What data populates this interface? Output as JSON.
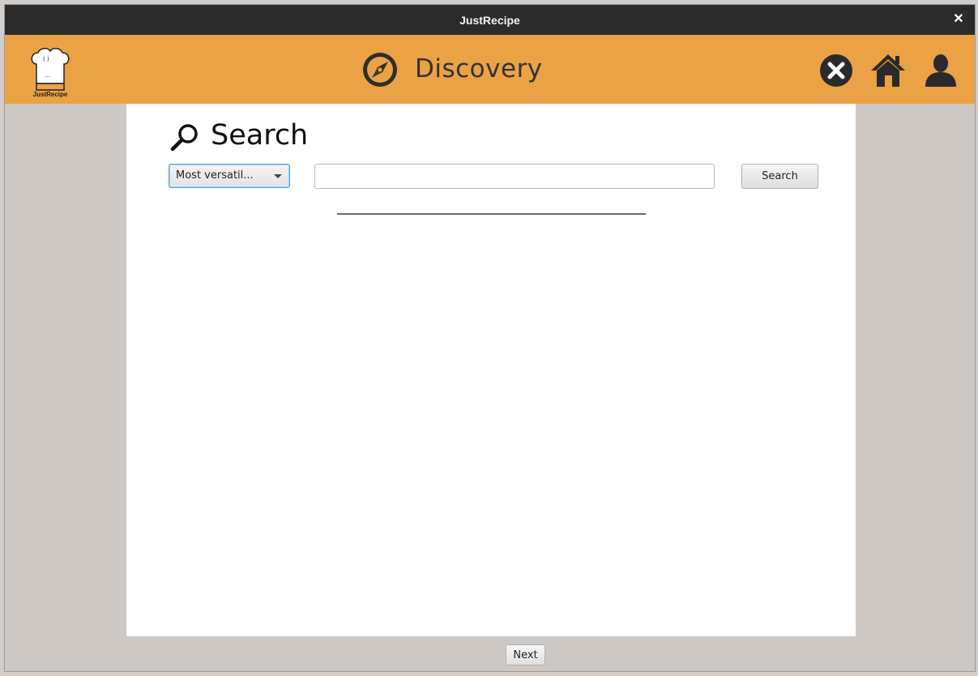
{
  "window": {
    "title": "JustRecipe",
    "close_glyph": "✕"
  },
  "header": {
    "logo_text": "JustRecipe",
    "logo_icon": "chef-hat-logo",
    "page_icon": "compass-icon",
    "page_title": "Discovery",
    "icons": [
      "close-circle-icon",
      "home-icon",
      "user-icon"
    ]
  },
  "search": {
    "heading": "Search",
    "heading_icon": "magnifier-icon",
    "filter_selected": "Most versatil...",
    "input_value": "",
    "input_placeholder": "",
    "button_label": "Search"
  },
  "footer": {
    "next_label": "Next"
  },
  "colors": {
    "header_bg": "#eba244",
    "titlebar_bg": "#2b2b2b",
    "content_bg": "#ffffff",
    "frame_bg": "#cdc8c4"
  }
}
